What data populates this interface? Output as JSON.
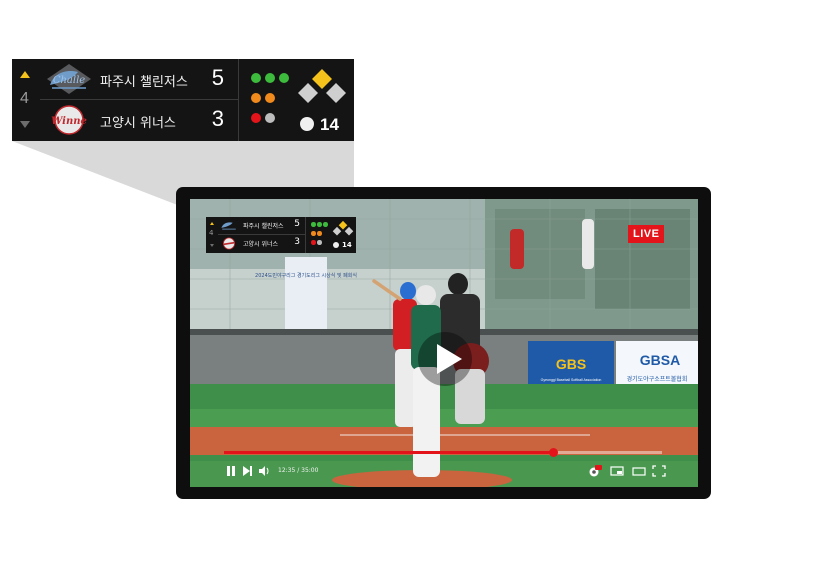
{
  "scoreboard": {
    "inning": "4",
    "inning_half": "top",
    "teams": [
      {
        "name": "파주시 챌린저스",
        "score": "5",
        "logo_text": "Challengers",
        "logo_color": "#4a78a8"
      },
      {
        "name": "고양시 위너스",
        "score": "3",
        "logo_text": "Winners",
        "logo_color": "#c0282d"
      }
    ],
    "count": {
      "balls": {
        "on": 3,
        "total": 3,
        "color": "#3dbb3c"
      },
      "strikes": {
        "on": 2,
        "total": 2,
        "color": "#f08a1c"
      },
      "outs": {
        "on": 1,
        "total": 2,
        "color": "#e3151b",
        "off_color": "#bdbdbd"
      }
    },
    "bases": {
      "first": false,
      "second": true,
      "third": false,
      "on_color": "#f4c21a",
      "off_color": "#cfcfcf"
    },
    "pitch_count": "14"
  },
  "live_label": "LIVE",
  "scene": {
    "banner_left": "2024도민야구리그 경기도리그 시상식 및 폐회식",
    "sponsor_1": "GBS",
    "sponsor_1_sub": "Gyeonggi Baseball Softball Association",
    "sponsor_2": "GBSA",
    "sponsor_2_sub": "경기도야구소프트볼협회"
  },
  "player": {
    "progress": 0.75,
    "time_label": "12:35 / 35:00",
    "accent_color": "#e3151b",
    "hd_badge": "HD",
    "controls": [
      "pause-icon",
      "next-icon",
      "volume-icon",
      "settings-icon",
      "miniplayer-icon",
      "theater-icon",
      "fullscreen-icon"
    ]
  }
}
